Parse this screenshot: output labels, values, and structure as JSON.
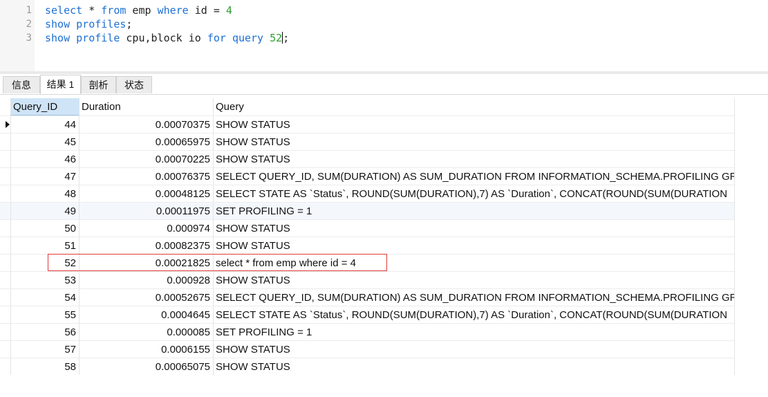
{
  "editor": {
    "lines": [
      {
        "number": "1",
        "tokens": [
          {
            "text": "select",
            "type": "kw"
          },
          {
            "text": " * ",
            "type": "plain"
          },
          {
            "text": "from",
            "type": "kw"
          },
          {
            "text": " emp ",
            "type": "plain"
          },
          {
            "text": "where",
            "type": "kw"
          },
          {
            "text": " id = ",
            "type": "plain"
          },
          {
            "text": "4",
            "type": "num"
          }
        ]
      },
      {
        "number": "2",
        "tokens": [
          {
            "text": "show",
            "type": "kw"
          },
          {
            "text": " ",
            "type": "plain"
          },
          {
            "text": "profiles",
            "type": "kw"
          },
          {
            "text": ";",
            "type": "plain"
          }
        ]
      },
      {
        "number": "3",
        "tokens": [
          {
            "text": "show",
            "type": "kw"
          },
          {
            "text": " ",
            "type": "plain"
          },
          {
            "text": "profile",
            "type": "kw"
          },
          {
            "text": " cpu,block io ",
            "type": "plain"
          },
          {
            "text": "for",
            "type": "kw"
          },
          {
            "text": " ",
            "type": "plain"
          },
          {
            "text": "query",
            "type": "kw"
          },
          {
            "text": " ",
            "type": "plain"
          },
          {
            "text": "52",
            "type": "num"
          },
          {
            "text": "|",
            "type": "caret"
          },
          {
            "text": ";",
            "type": "plain"
          }
        ]
      }
    ]
  },
  "tabs": [
    {
      "label": "信息",
      "active": false
    },
    {
      "label": "结果 1",
      "active": true
    },
    {
      "label": "剖析",
      "active": false
    },
    {
      "label": "状态",
      "active": false
    }
  ],
  "grid": {
    "columns": [
      "Query_ID",
      "Duration",
      "Query"
    ],
    "selected_column": 0,
    "current_row": 0,
    "highlighted_row": 8,
    "rows": [
      {
        "id": "44",
        "duration": "0.00070375",
        "query": "SHOW STATUS"
      },
      {
        "id": "45",
        "duration": "0.00065975",
        "query": "SHOW STATUS"
      },
      {
        "id": "46",
        "duration": "0.00070225",
        "query": "SHOW STATUS"
      },
      {
        "id": "47",
        "duration": "0.00076375",
        "query": "SELECT QUERY_ID, SUM(DURATION) AS SUM_DURATION FROM INFORMATION_SCHEMA.PROFILING GR"
      },
      {
        "id": "48",
        "duration": "0.00048125",
        "query": "SELECT STATE AS `Status`, ROUND(SUM(DURATION),7) AS `Duration`, CONCAT(ROUND(SUM(DURATION"
      },
      {
        "id": "49",
        "duration": "0.00011975",
        "query": "SET PROFILING = 1"
      },
      {
        "id": "50",
        "duration": "0.000974",
        "query": "SHOW STATUS"
      },
      {
        "id": "51",
        "duration": "0.00082375",
        "query": "SHOW STATUS"
      },
      {
        "id": "52",
        "duration": "0.00021825",
        "query": "select * from emp where id = 4"
      },
      {
        "id": "53",
        "duration": "0.000928",
        "query": "SHOW STATUS"
      },
      {
        "id": "54",
        "duration": "0.00052675",
        "query": "SELECT QUERY_ID, SUM(DURATION) AS SUM_DURATION FROM INFORMATION_SCHEMA.PROFILING GR"
      },
      {
        "id": "55",
        "duration": "0.0004645",
        "query": "SELECT STATE AS `Status`, ROUND(SUM(DURATION),7) AS `Duration`, CONCAT(ROUND(SUM(DURATION"
      },
      {
        "id": "56",
        "duration": "0.000085",
        "query": "SET PROFILING = 1"
      },
      {
        "id": "57",
        "duration": "0.0006155",
        "query": "SHOW STATUS"
      },
      {
        "id": "58",
        "duration": "0.00065075",
        "query": "SHOW STATUS"
      }
    ]
  },
  "colors": {
    "keyword": "#1c6fd3",
    "number": "#2e9e2e",
    "highlight_border": "#e0393b",
    "selected_header": "#cfe4f7"
  }
}
